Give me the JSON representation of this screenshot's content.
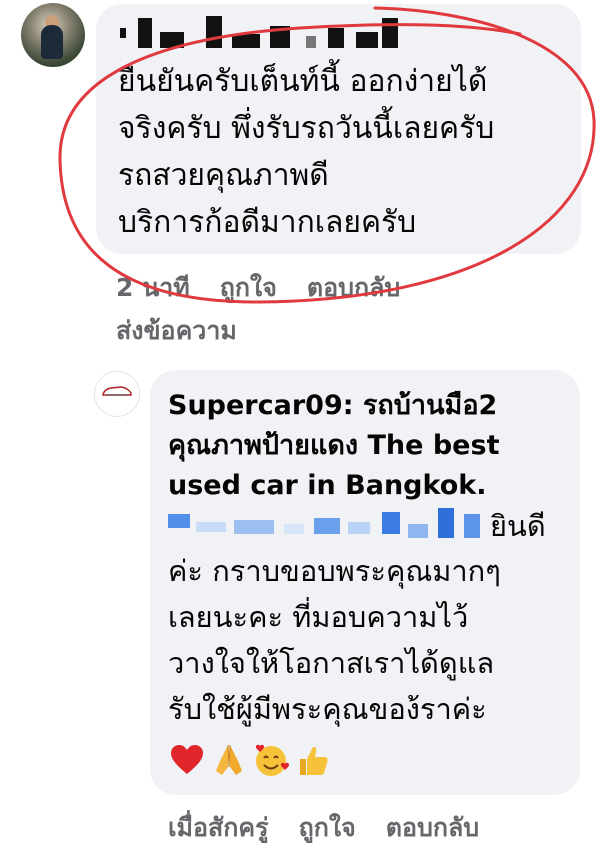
{
  "comment_1": {
    "text_lines": [
      "ยืนยันครับเต็นท์นี้ ออกง่ายได้",
      "จริงครับ พึ่งรับรถวันนี้เลยครับ",
      "รถสวยคุณภาพดี",
      "บริการก้อดีมากเลยครับ"
    ],
    "time": "2 นาที",
    "like_label": "ถูกใจ",
    "reply_label": "ตอบกลับ",
    "message_label": "ส่งข้อความ"
  },
  "comment_2": {
    "sender_lines": [
      "Supercar09: รถบ้านมือ2",
      "คุณภาพป้ายแดง The best",
      "used car in Bangkok."
    ],
    "mention_tail": "ยินดี",
    "text_lines": [
      "ค่ะ กราบขอบพระคุณมากๆ",
      "เลยนะคะ ที่มอบความไว้",
      "วางใจให้โอกาสเราได้ดูแล",
      "รับใช้ผู้มีพระคุณของ้ราค่ะ"
    ],
    "emojis": [
      "red-heart-icon",
      "folded-hands-icon",
      "smiling-face-with-hearts-icon",
      "thumbs-up-icon"
    ],
    "time": "เมื่อสักครู่",
    "like_label": "ถูกใจ",
    "reply_label": "ตอบกลับ"
  },
  "colors": {
    "bubble": "#f0f2f5",
    "meta_text": "#65676b",
    "annotation_red": "#e0393e"
  }
}
